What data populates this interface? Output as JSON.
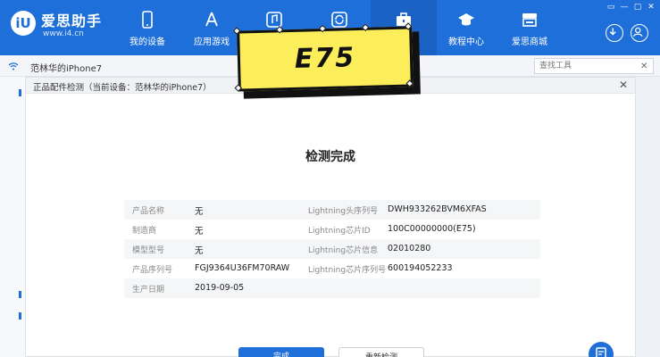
{
  "app": {
    "brand": "爱思助手",
    "url": "www.i4.cn",
    "logo_text": "iU"
  },
  "nav": [
    {
      "label": "我的设备",
      "icon": "phone-icon"
    },
    {
      "label": "应用游戏",
      "icon": "app-store-icon"
    },
    {
      "label": "",
      "icon": "music-icon"
    },
    {
      "label": "",
      "icon": "refresh-icon"
    },
    {
      "label": "",
      "icon": "toolbox-icon"
    },
    {
      "label": "教程中心",
      "icon": "graduation-cap-icon"
    },
    {
      "label": "爱思商城",
      "icon": "store-icon"
    }
  ],
  "window_controls": [
    "▭",
    "—",
    "▢",
    "✕"
  ],
  "device": {
    "name": "范林华的iPhone7",
    "search_placeholder": "查找工具"
  },
  "dialog": {
    "title": "正品配件检测（当前设备：范林华的iPhone7）",
    "close": "✕",
    "result_title": "检测完成",
    "rows": [
      {
        "k1": "产品名称",
        "v1": "无",
        "k2": "Lightning头序列号",
        "v2": "DWH933262BVM6XFAS"
      },
      {
        "k1": "制造商",
        "v1": "无",
        "k2": "Lightning芯片ID",
        "v2": "100C00000000(E75)"
      },
      {
        "k1": "模型型号",
        "v1": "无",
        "k2": "Lightning芯片信息",
        "v2": "02010280"
      },
      {
        "k1": "产品序列号",
        "v1": "FGJ9364U36FM70RAW",
        "k2": "Lightning芯片序列号",
        "v2": "600194052233"
      },
      {
        "k1": "生产日期",
        "v1": "2019-09-05",
        "k2": "",
        "v2": ""
      }
    ],
    "done_button": "完成",
    "retry_button": "重新检测"
  },
  "sticker": {
    "text": "E75"
  },
  "colors": {
    "primary": "#1e6fd9",
    "sticker": "#fcee5a"
  }
}
